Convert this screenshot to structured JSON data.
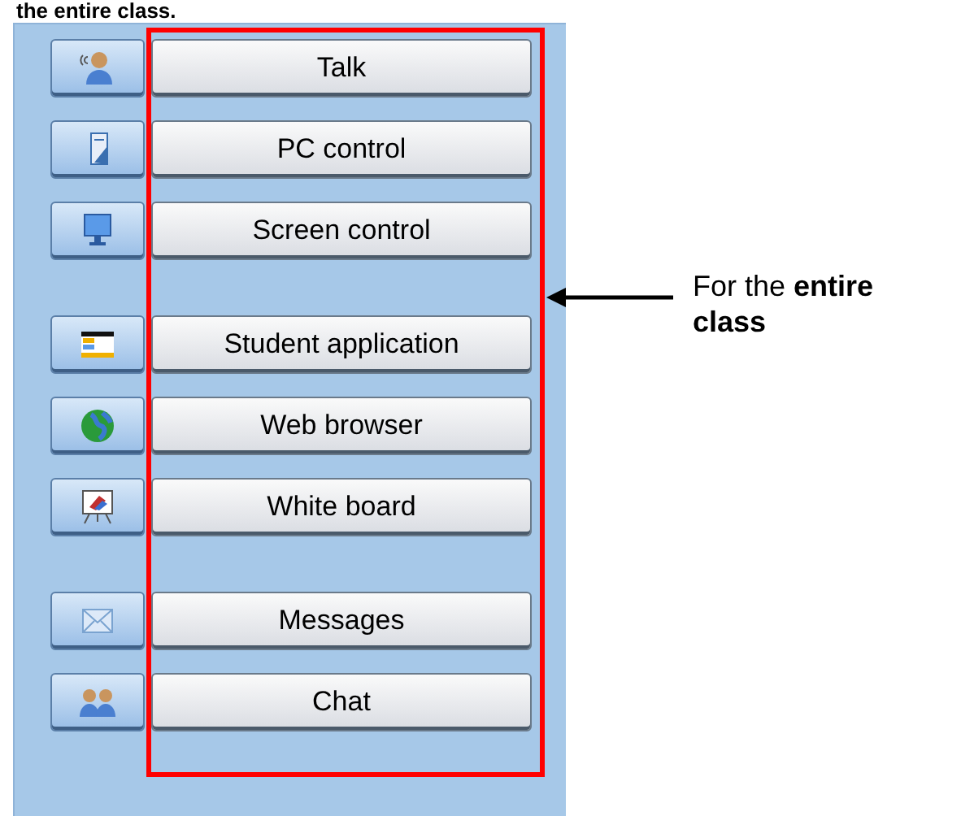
{
  "heading": "the entire class.",
  "groups": [
    {
      "buttons": [
        {
          "kind": "talk",
          "label": "Talk"
        },
        {
          "kind": "pc",
          "label": "PC control"
        },
        {
          "kind": "screen",
          "label": "Screen control"
        }
      ]
    },
    {
      "buttons": [
        {
          "kind": "app",
          "label": "Student application"
        },
        {
          "kind": "globe",
          "label": "Web browser"
        },
        {
          "kind": "board",
          "label": "White board"
        }
      ]
    },
    {
      "buttons": [
        {
          "kind": "mail",
          "label": "Messages"
        },
        {
          "kind": "chat",
          "label": "Chat"
        }
      ]
    }
  ],
  "annotation": "For the **entire class**"
}
